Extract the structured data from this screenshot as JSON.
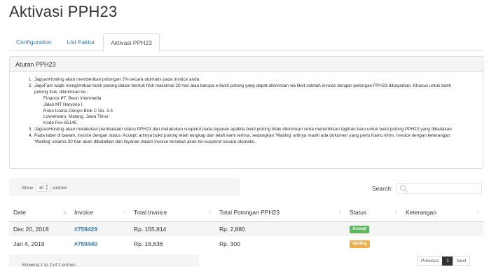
{
  "page": {
    "title": "Aktivasi PPH23"
  },
  "tabs": [
    {
      "label": "Configuration",
      "active": false
    },
    {
      "label": "List Faktur",
      "active": false
    },
    {
      "label": "Aktivasi PPH23",
      "active": true
    }
  ],
  "rules": {
    "heading": "Aturan PPH23",
    "item1": "JagoanHosting akan memberikan potongan 2% secara otomatis pada invoice anda",
    "item2_intro": "JagoFam wajib mengirimkan bukti potong dalam bentuk fisik maksimal 20 hari atau berupa e-bukti potong yang dapat dikirimkan via tiket setelah invoice dengan potongan PPH23 dibayarkan. Khusus untuk bukti potong fisik, dikirimkan ke :",
    "address": [
      "Finance PT. Beon Intermedia",
      "Jalan MT Haryono I,",
      "Ruko Istana Dinoyo Blok C No. 3-4",
      "Lowokwaru, Malang, Jawa Timur",
      "Kode Pos 65145"
    ],
    "item3": "JagoanHosting akan melakukan pembatalan status PPH23 dan melakukan suspend pada layanan apabila bukti potong tidak dikirimkan serta menerbitkan tagihan baru untuk bukti potong PPH23 yang dibatalkan",
    "item4": "Pada tabel di bawah, invoice dengan status 'Accept' artinya bukti potong telah lengkap dan telah kami terima, sedangkan 'Waiting' artinya masih ada dokumen yang perlu Kamu kirim. Invoice dengan keterangan 'Waiting' selama 20 hari akan dibatalkan dan layanan dalam invoice tersebut akan ter-suspend secara otomatis."
  },
  "table_controls": {
    "show_label": "Show",
    "entries_value": "10",
    "entries_label": "entries",
    "search_label": "Search:",
    "search_icon": "search-icon"
  },
  "table": {
    "columns": [
      "Date",
      "Invoice",
      "Total Invoice",
      "Total Potongan PPH23",
      "Status",
      "Keterangan"
    ],
    "rows": [
      {
        "date": "Dec 20, 2018",
        "invoice": "#759429",
        "total_invoice": "Rp. 155,814",
        "total_potongan": "Rp. 2,880",
        "status": "Accept",
        "status_color": "#5cb85c",
        "keterangan": ""
      },
      {
        "date": "Jan 4, 2019",
        "invoice": "#759440",
        "total_invoice": "Rp. 16,636",
        "total_potongan": "Rp. 300",
        "status": "Waiting",
        "status_color": "#f0ad4e",
        "keterangan": ""
      }
    ]
  },
  "footer": {
    "info": "Showing 1 to 2 of 2 entries",
    "previous": "Previous",
    "current_page": "1",
    "next": "Next"
  }
}
